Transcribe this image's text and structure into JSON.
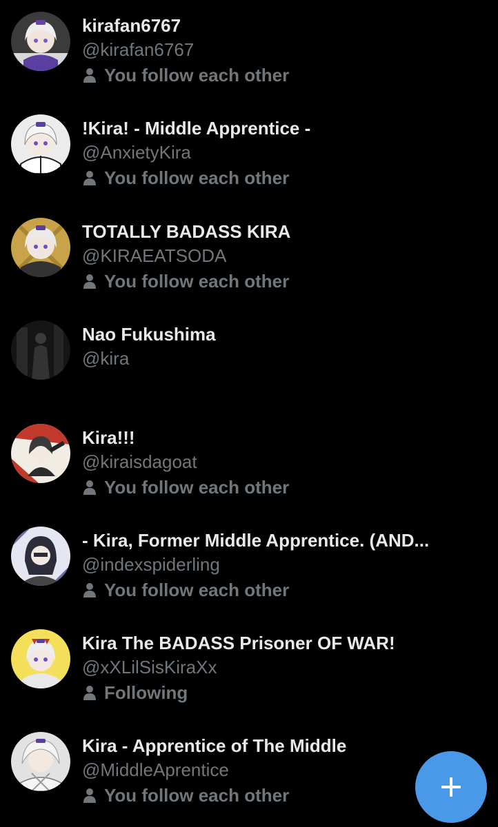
{
  "accent_color": "#4a99e9",
  "users": [
    {
      "name": "kirafan6767",
      "handle": "@kirafan6767",
      "status": "You follow each other",
      "status_icon": "person-icon",
      "avatar_bg": "#2a2a2a"
    },
    {
      "name": "!Kira! - Middle Apprentice -",
      "handle": "@AnxietyKira",
      "status": "You follow each other",
      "status_icon": "person-icon",
      "avatar_bg": "#e8e8e8"
    },
    {
      "name": "TOTALLY BADASS KIRA",
      "handle": "@KIRAEATSODA",
      "status": "You follow each other",
      "status_icon": "person-icon",
      "avatar_bg": "#c9a34a"
    },
    {
      "name": "Nao Fukushima",
      "handle": "@kira",
      "status": "",
      "status_icon": "",
      "avatar_bg": "#1a1a1a"
    },
    {
      "name": "Kira!!!",
      "handle": "@kiraisdagoat",
      "status": "You follow each other",
      "status_icon": "person-icon",
      "avatar_bg": "#c0392b"
    },
    {
      "name": "- Kira, Former Middle Apprentice. (AND...",
      "handle": "@indexspiderling",
      "status": "You follow each other",
      "status_icon": "person-icon",
      "avatar_bg": "#6a6fa8"
    },
    {
      "name": "Kira The BADASS Prisoner OF WAR!",
      "handle": "@xXLilSisKiraXx",
      "status": "Following",
      "status_icon": "person-icon",
      "avatar_bg": "#e9d24a"
    },
    {
      "name": "Kira - Apprentice of The Middle",
      "handle": "@MiddleAprentice",
      "status": "You follow each other",
      "status_icon": "person-icon",
      "avatar_bg": "#d9d9d9"
    }
  ],
  "fab": {
    "icon": "plus-icon"
  }
}
